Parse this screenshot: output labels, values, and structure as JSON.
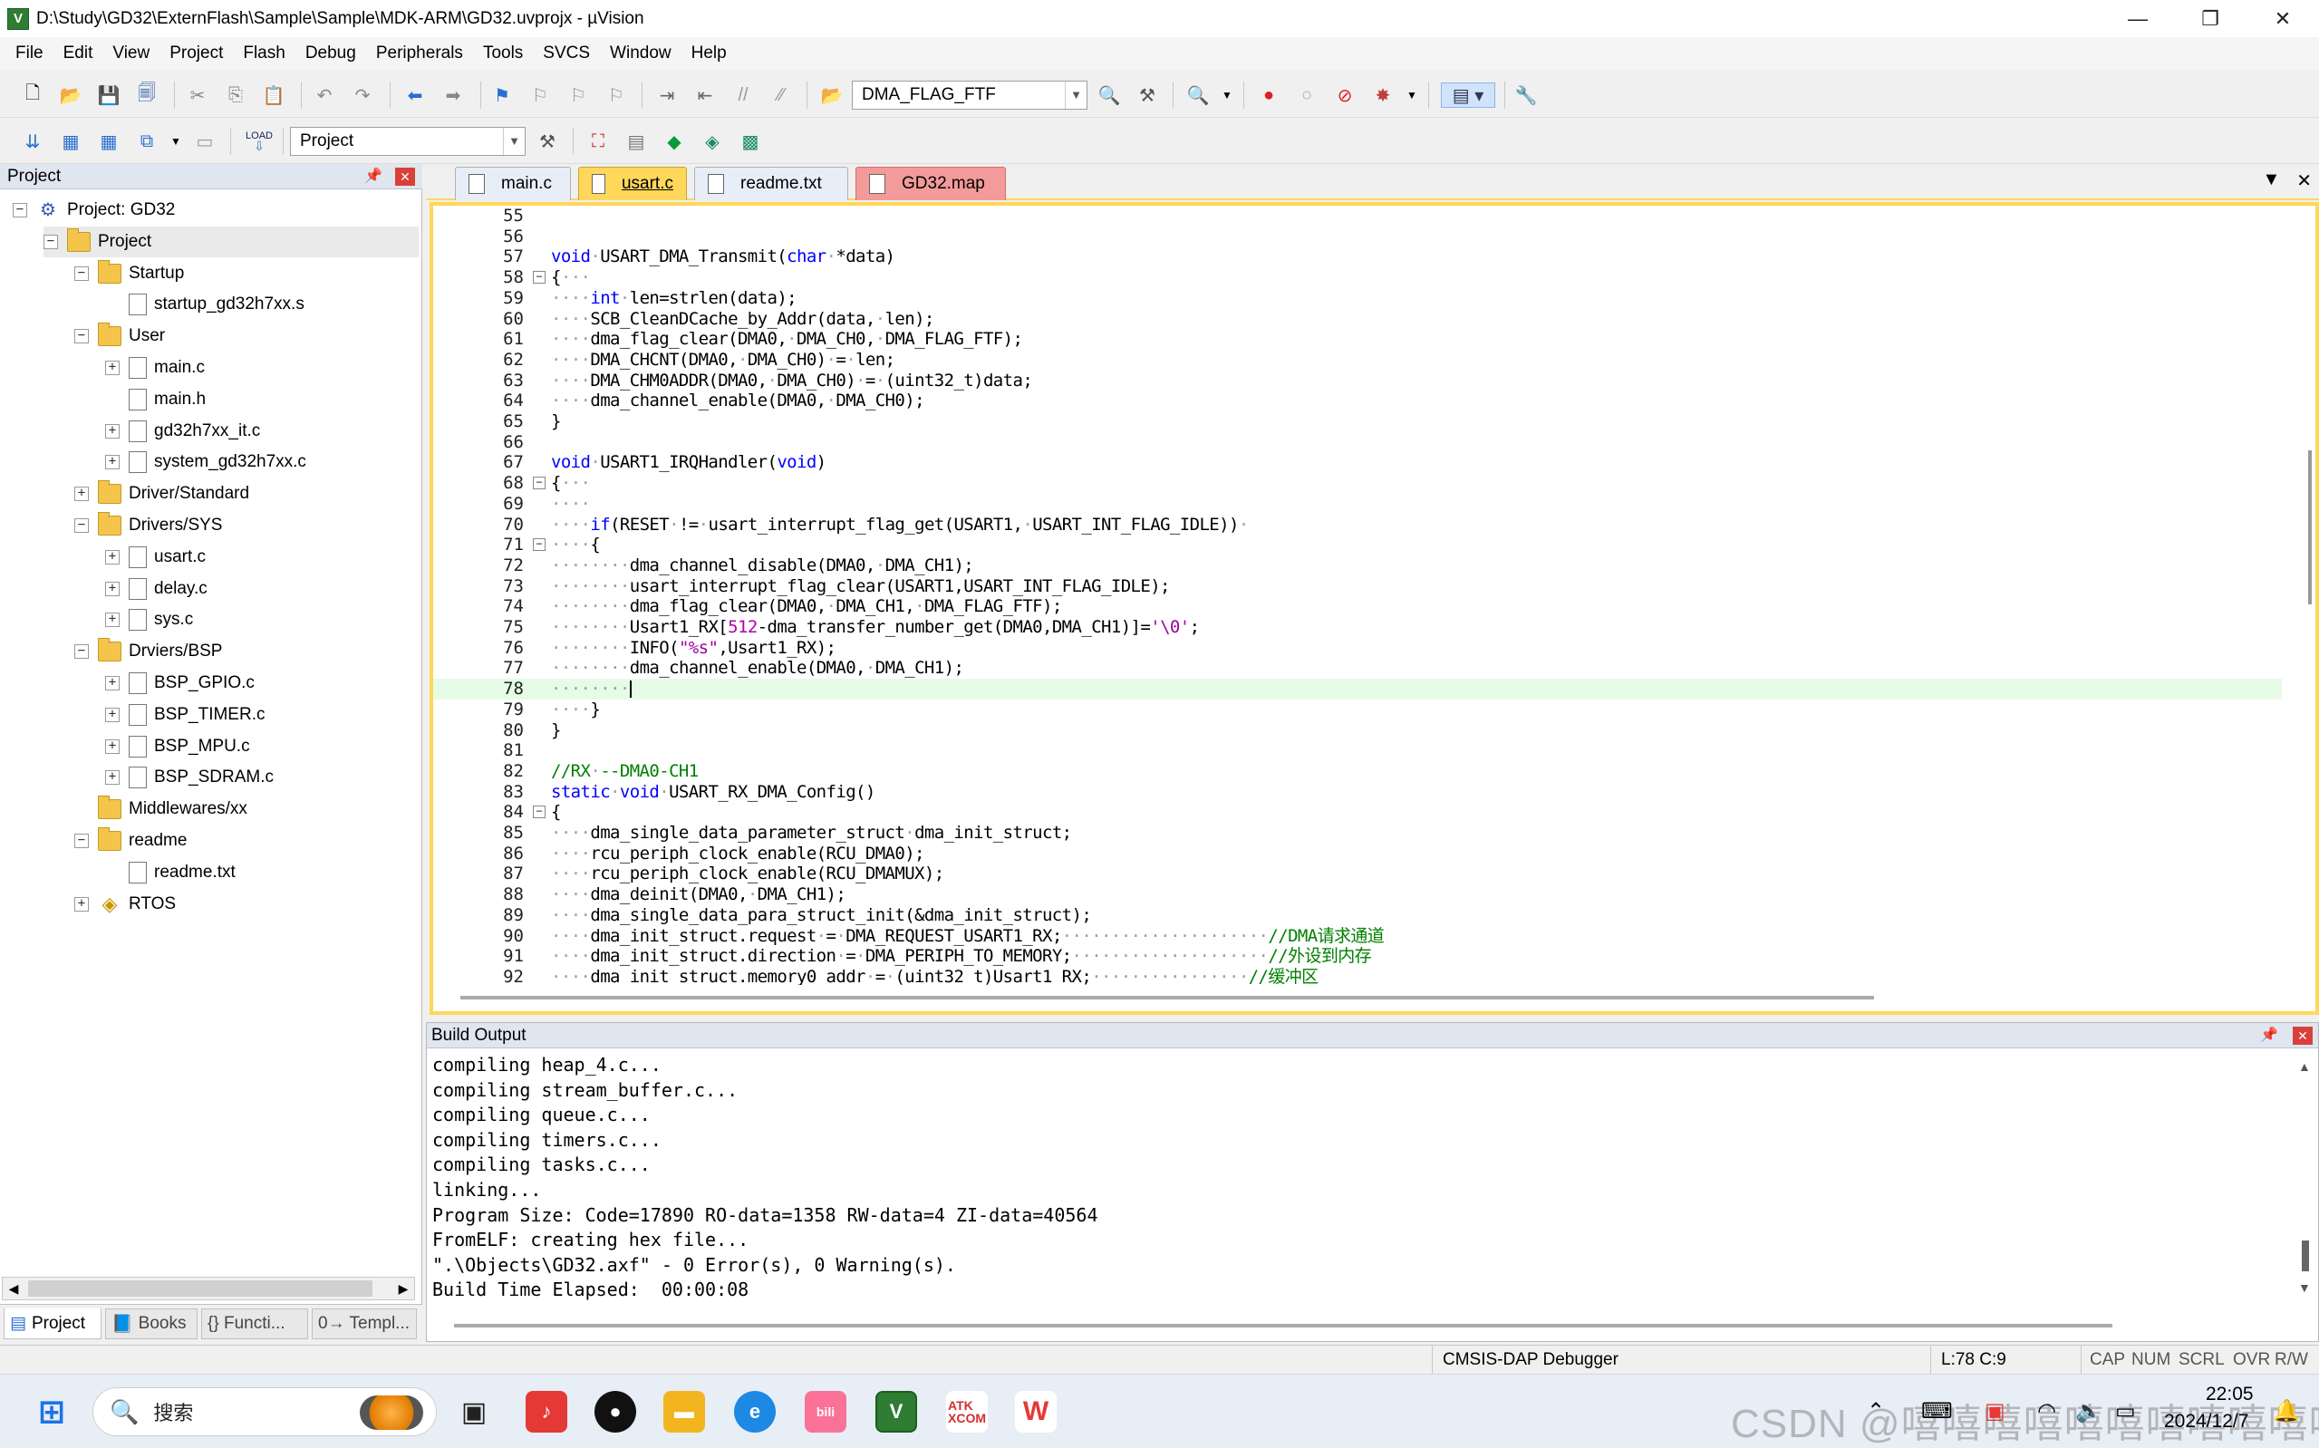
{
  "window": {
    "title": "D:\\Study\\GD32\\ExternFlash\\Sample\\Sample\\MDK-ARM\\GD32.uvprojx - µVision",
    "app_icon": "V",
    "controls": [
      "—",
      "❐",
      "✕"
    ]
  },
  "menu": [
    "File",
    "Edit",
    "View",
    "Project",
    "Flash",
    "Debug",
    "Peripherals",
    "Tools",
    "SVCS",
    "Window",
    "Help"
  ],
  "toolbar": {
    "find_combo_value": "DMA_FLAG_FTF",
    "target_combo_value": "Project",
    "load_label": "LOAD"
  },
  "project_pane": {
    "title": "Project",
    "tree": [
      {
        "label": "Project: GD32",
        "depth": 0,
        "toggle": "−",
        "icon": "project"
      },
      {
        "label": "Project",
        "depth": 1,
        "toggle": "−",
        "icon": "folder-open",
        "selected": true
      },
      {
        "label": "Startup",
        "depth": 2,
        "toggle": "−",
        "icon": "folder"
      },
      {
        "label": "startup_gd32h7xx.s",
        "depth": 3,
        "toggle": "",
        "icon": "file"
      },
      {
        "label": "User",
        "depth": 2,
        "toggle": "−",
        "icon": "folder"
      },
      {
        "label": "main.c",
        "depth": 3,
        "toggle": "+",
        "icon": "file"
      },
      {
        "label": "main.h",
        "depth": 3,
        "toggle": "",
        "icon": "file"
      },
      {
        "label": "gd32h7xx_it.c",
        "depth": 3,
        "toggle": "+",
        "icon": "file"
      },
      {
        "label": "system_gd32h7xx.c",
        "depth": 3,
        "toggle": "+",
        "icon": "file"
      },
      {
        "label": "Driver/Standard",
        "depth": 2,
        "toggle": "+",
        "icon": "folder"
      },
      {
        "label": "Drivers/SYS",
        "depth": 2,
        "toggle": "−",
        "icon": "folder"
      },
      {
        "label": "usart.c",
        "depth": 3,
        "toggle": "+",
        "icon": "file"
      },
      {
        "label": "delay.c",
        "depth": 3,
        "toggle": "+",
        "icon": "file"
      },
      {
        "label": "sys.c",
        "depth": 3,
        "toggle": "+",
        "icon": "file"
      },
      {
        "label": "Drviers/BSP",
        "depth": 2,
        "toggle": "−",
        "icon": "folder"
      },
      {
        "label": "BSP_GPIO.c",
        "depth": 3,
        "toggle": "+",
        "icon": "file"
      },
      {
        "label": "BSP_TIMER.c",
        "depth": 3,
        "toggle": "+",
        "icon": "file"
      },
      {
        "label": "BSP_MPU.c",
        "depth": 3,
        "toggle": "+",
        "icon": "file"
      },
      {
        "label": "BSP_SDRAM.c",
        "depth": 3,
        "toggle": "+",
        "icon": "file"
      },
      {
        "label": "Middlewares/xx",
        "depth": 2,
        "toggle": "",
        "icon": "folder"
      },
      {
        "label": "readme",
        "depth": 2,
        "toggle": "−",
        "icon": "folder"
      },
      {
        "label": "readme.txt",
        "depth": 3,
        "toggle": "",
        "icon": "file"
      },
      {
        "label": "RTOS",
        "depth": 2,
        "toggle": "+",
        "icon": "rtos"
      }
    ],
    "bottom_tabs": [
      "Project",
      "Books",
      "{} Functi...",
      "0→ Templ..."
    ]
  },
  "editor": {
    "tabs": [
      {
        "label": "main.c",
        "state": "normal"
      },
      {
        "label": "usart.c",
        "state": "active"
      },
      {
        "label": "readme.txt",
        "state": "normal"
      },
      {
        "label": "GD32.map",
        "state": "map"
      }
    ],
    "current_line": 78,
    "lines": [
      {
        "n": "55",
        "fold": "",
        "html": ""
      },
      {
        "n": "56",
        "fold": "",
        "html": ""
      },
      {
        "n": "57",
        "fold": "",
        "html": "<span class=\"kw\">void</span>·USART_DMA_Transmit(<span class=\"kw\">char</span>·*data)"
      },
      {
        "n": "58",
        "fold": "−",
        "html": "{···"
      },
      {
        "n": "59",
        "fold": "",
        "html": "····<span class=\"kw\">int</span>·len=strlen(data);"
      },
      {
        "n": "60",
        "fold": "",
        "html": "····SCB_CleanDCache_by_Addr(data,·len);"
      },
      {
        "n": "61",
        "fold": "",
        "html": "····dma_flag_clear(DMA0,·DMA_CH0,·DMA_FLAG_FTF);"
      },
      {
        "n": "62",
        "fold": "",
        "html": "····DMA_CHCNT(DMA0,·DMA_CH0)·=·len;"
      },
      {
        "n": "63",
        "fold": "",
        "html": "····DMA_CHM0ADDR(DMA0,·DMA_CH0)·=·(uint32_t)data;"
      },
      {
        "n": "64",
        "fold": "",
        "html": "····dma_channel_enable(DMA0,·DMA_CH0);"
      },
      {
        "n": "65",
        "fold": "",
        "html": "}"
      },
      {
        "n": "66",
        "fold": "",
        "html": ""
      },
      {
        "n": "67",
        "fold": "",
        "html": "<span class=\"kw\">void</span>·USART1_IRQHandler(<span class=\"kw\">void</span>)"
      },
      {
        "n": "68",
        "fold": "−",
        "html": "{···"
      },
      {
        "n": "69",
        "fold": "",
        "html": "····"
      },
      {
        "n": "70",
        "fold": "",
        "html": "····<span class=\"kw\">if</span>(RESET·!=·usart_interrupt_flag_get(USART1,·USART_INT_FLAG_IDLE))·"
      },
      {
        "n": "71",
        "fold": "−",
        "html": "····{"
      },
      {
        "n": "72",
        "fold": "",
        "html": "········dma_channel_disable(DMA0,·DMA_CH1);"
      },
      {
        "n": "73",
        "fold": "",
        "html": "········usart_interrupt_flag_clear(USART1,USART_INT_FLAG_IDLE);"
      },
      {
        "n": "74",
        "fold": "",
        "html": "········dma_flag_clear(DMA0,·DMA_CH1,·DMA_FLAG_FTF);"
      },
      {
        "n": "75",
        "fold": "",
        "html": "········Usart1_RX[<span class=\"nu\">512</span>-dma_transfer_number_get(DMA0,DMA_CH1)]=<span class=\"st\">'\\0'</span>;"
      },
      {
        "n": "76",
        "fold": "",
        "html": "········INFO(<span class=\"st\">\"%s\"</span>,Usart1_RX);"
      },
      {
        "n": "77",
        "fold": "",
        "html": "········dma_channel_enable(DMA0,·DMA_CH1);"
      },
      {
        "n": "78",
        "fold": "",
        "html": "········<span class=\"caret\"></span>"
      },
      {
        "n": "79",
        "fold": "",
        "html": "····}"
      },
      {
        "n": "80",
        "fold": "",
        "html": "}"
      },
      {
        "n": "81",
        "fold": "",
        "html": ""
      },
      {
        "n": "82",
        "fold": "",
        "html": "<span class=\"cm\">//RX·--DMA0-CH1</span>"
      },
      {
        "n": "83",
        "fold": "",
        "html": "<span class=\"kw\">static</span>·<span class=\"kw\">void</span>·USART_RX_DMA_Config()"
      },
      {
        "n": "84",
        "fold": "−",
        "html": "{"
      },
      {
        "n": "85",
        "fold": "",
        "html": "····dma_single_data_parameter_struct·dma_init_struct;"
      },
      {
        "n": "86",
        "fold": "",
        "html": "····rcu_periph_clock_enable(RCU_DMA0);"
      },
      {
        "n": "87",
        "fold": "",
        "html": "····rcu_periph_clock_enable(RCU_DMAMUX);"
      },
      {
        "n": "88",
        "fold": "",
        "html": "····dma_deinit(DMA0,·DMA_CH1);"
      },
      {
        "n": "89",
        "fold": "",
        "html": "····dma_single_data_para_struct_init(&amp;dma_init_struct);"
      },
      {
        "n": "90",
        "fold": "",
        "html": "····dma_init_struct.request·=·DMA_REQUEST_USART1_RX;·····················<span class=\"cm\">//DMA请求通道</span>"
      },
      {
        "n": "91",
        "fold": "",
        "html": "····dma_init_struct.direction·=·DMA_PERIPH_TO_MEMORY;····················<span class=\"cm\">//外设到内存</span>"
      },
      {
        "n": "92",
        "fold": "",
        "html": "····dma_init_struct.memory0_addr·=·(uint32_t)Usart1_RX;················<span class=\"cm\">//缓冲区</span>"
      }
    ]
  },
  "build_output": {
    "title": "Build Output",
    "lines": [
      "compiling heap_4.c...",
      "compiling stream_buffer.c...",
      "compiling queue.c...",
      "compiling timers.c...",
      "compiling tasks.c...",
      "linking...",
      "Program Size: Code=17890 RO-data=1358 RW-data=4 ZI-data=40564",
      "FromELF: creating hex file...",
      "\".\\Objects\\GD32.axf\" - 0 Error(s), 0 Warning(s).",
      "Build Time Elapsed:  00:00:08"
    ]
  },
  "status": {
    "debugger": "CMSIS-DAP Debugger",
    "position": "L:78 C:9",
    "indicators": [
      "CAP",
      "NUM",
      "SCRL",
      "OVR",
      "R/W"
    ]
  },
  "taskbar": {
    "search_placeholder": "搜索",
    "watermark": "CSDN @嘻嘻嘻嘻嘻嘻嘻嘻嘻嘻嘻",
    "time": "22:05",
    "date": "2024/12/7"
  },
  "colors": {
    "editor_border": "#ffd75a",
    "active_tab": "#ffd75a",
    "map_tab": "#f39a9a",
    "keyword": "#0000ff",
    "comment": "#008000",
    "current_line_bg": "#e6fce6"
  }
}
